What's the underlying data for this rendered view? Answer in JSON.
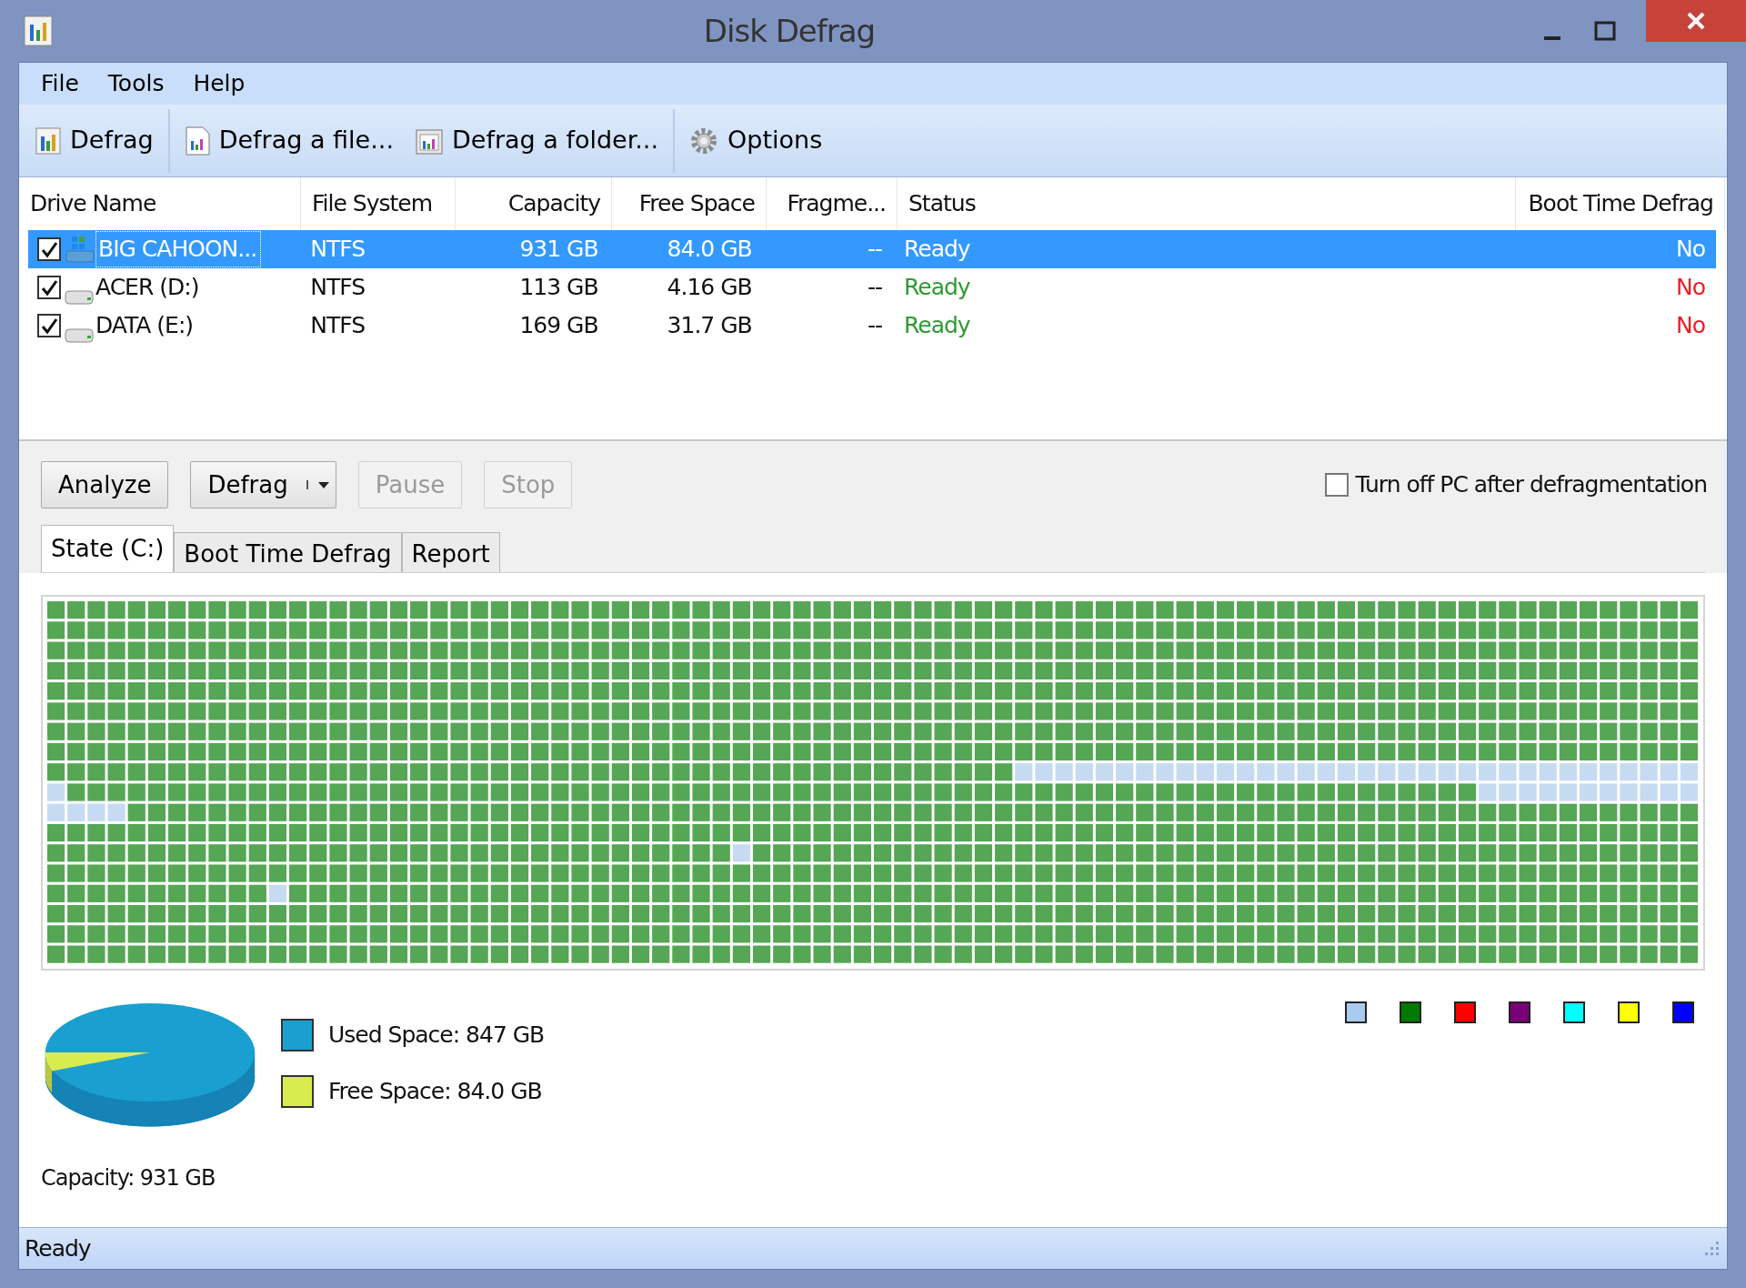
{
  "window": {
    "title": "Disk Defrag"
  },
  "menu": [
    "File",
    "Tools",
    "Help"
  ],
  "toolbar": [
    {
      "label": "Defrag"
    },
    {
      "label": "Defrag a file..."
    },
    {
      "label": "Defrag a folder..."
    },
    {
      "label": "Options"
    }
  ],
  "drives": {
    "columns": [
      "Drive Name",
      "File System",
      "Capacity",
      "Free Space",
      "Fragme...",
      "Status",
      "Boot Time Defrag"
    ],
    "rows": [
      {
        "checked": true,
        "selected": true,
        "kind": "system",
        "name": "BIG CAHOON...",
        "fs": "NTFS",
        "capacity": "931 GB",
        "free": "84.0 GB",
        "frag": "--",
        "status": "Ready",
        "boot": "No"
      },
      {
        "checked": true,
        "selected": false,
        "kind": "disk",
        "name": "ACER (D:)",
        "fs": "NTFS",
        "capacity": "113 GB",
        "free": "4.16 GB",
        "frag": "--",
        "status": "Ready",
        "boot": "No"
      },
      {
        "checked": true,
        "selected": false,
        "kind": "disk",
        "name": "DATA (E:)",
        "fs": "NTFS",
        "capacity": "169 GB",
        "free": "31.7 GB",
        "frag": "--",
        "status": "Ready",
        "boot": "No"
      }
    ]
  },
  "actions": [
    {
      "label": "Analyze",
      "disabled": false,
      "kind": "plain"
    },
    {
      "label": "Defrag",
      "disabled": false,
      "kind": "split"
    },
    {
      "label": "Pause",
      "disabled": true,
      "kind": "plain"
    },
    {
      "label": "Stop",
      "disabled": true,
      "kind": "plain"
    }
  ],
  "turn_off": {
    "label": "Turn off PC after defragmentation",
    "checked": false
  },
  "tabs": [
    {
      "label": "State (C:)",
      "selected": true
    },
    {
      "label": "Boot Time Defrag",
      "selected": false
    },
    {
      "label": "Report",
      "selected": false
    }
  ],
  "block_legend": [
    {
      "color": "#a9cbee"
    },
    {
      "color": "#007a00"
    },
    {
      "color": "#ff0000"
    },
    {
      "color": "#7a007a"
    },
    {
      "color": "#00ffff"
    },
    {
      "color": "#ffff00"
    },
    {
      "color": "#0000ff"
    }
  ],
  "space_legend": [
    {
      "label": "Used Space: 847 GB",
      "color": "#1aa0d0"
    },
    {
      "label": "Free Space: 84.0 GB",
      "color": "#d8ec50"
    }
  ],
  "capacity": "Capacity: 931 GB",
  "status_bar": "Ready"
}
